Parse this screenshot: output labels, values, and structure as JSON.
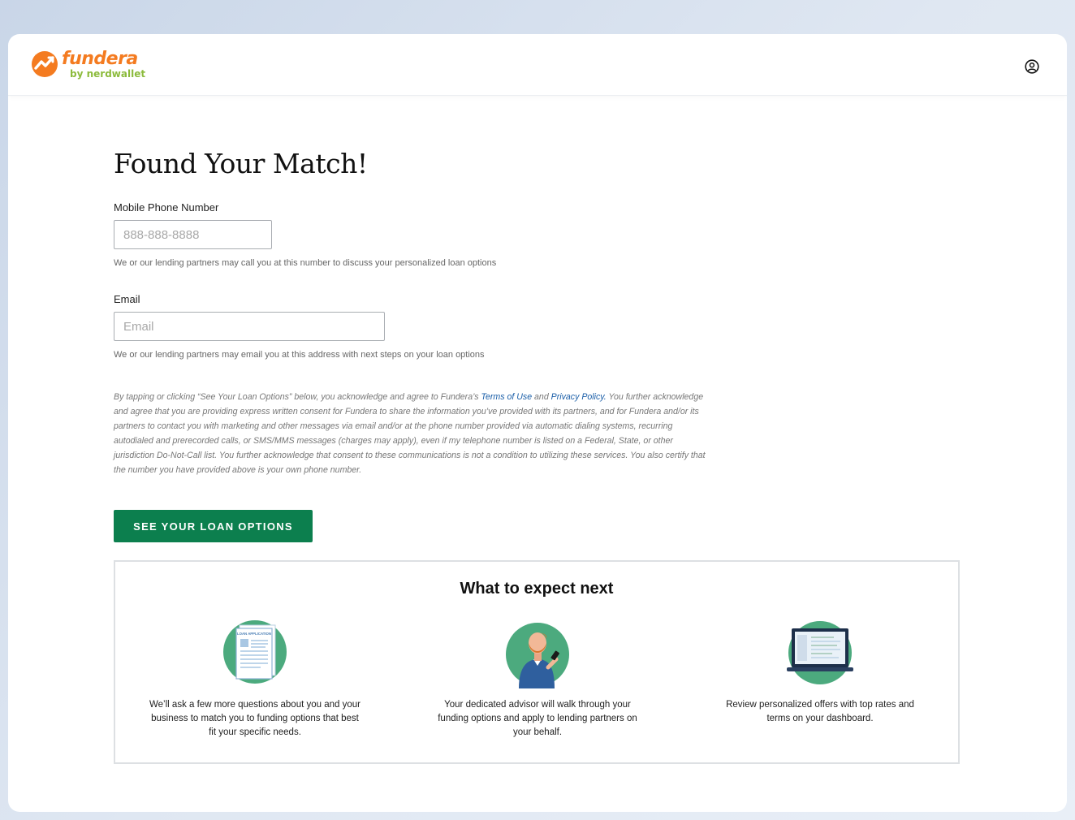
{
  "brand": {
    "name": "fundera",
    "sub": "by nerdwallet",
    "primary_color": "#f47b20",
    "secondary_color": "#8cbb3c"
  },
  "header": {
    "account_icon": "user-circle-icon"
  },
  "page": {
    "title": "Found Your Match!"
  },
  "phone": {
    "label": "Mobile Phone Number",
    "placeholder": "888-888-8888",
    "value": "",
    "helper": "We or our lending partners may call you at this number to discuss your personalized loan options"
  },
  "email": {
    "label": "Email",
    "placeholder": "Email",
    "value": "",
    "helper": "We or our lending partners may email you at this address with next steps on your loan options"
  },
  "consent": {
    "pre": "By tapping or clicking “See Your Loan Options” below, you acknowledge and agree to Fundera’s ",
    "terms_link": "Terms of Use",
    "and": " and ",
    "privacy_link": "Privacy Policy.",
    "post": " You further acknowledge and agree that you are providing express written consent for Fundera to share the information you’ve provided with its partners, and for Fundera and/or its partners to contact you with marketing and other messages via email and/or at the phone number provided via automatic dialing systems, recurring autodialed and prerecorded calls, or SMS/MMS messages (charges may apply), even if my telephone number is listed on a Federal, State, or other jurisdiction Do-Not-Call list. You further acknowledge that consent to these communications is not a condition to utilizing these services. You also certify that the number you have provided above is your own phone number.",
    "link_color": "#1a5ea8"
  },
  "cta": {
    "label": "SEE YOUR LOAN OPTIONS",
    "color": "#0c7f4e"
  },
  "next": {
    "title": "What to expect next",
    "steps": [
      {
        "icon": "loan-application-icon",
        "illus_label": "LOAN APPLICATION",
        "text": "We’ll ask a few more questions about you and your business to match you to funding options that best fit your specific needs."
      },
      {
        "icon": "advisor-icon",
        "text": "Your dedicated advisor will walk through your funding options and apply to lending partners on your behalf."
      },
      {
        "icon": "dashboard-laptop-icon",
        "text": "Review personalized offers with top rates and terms on your dashboard."
      }
    ]
  }
}
